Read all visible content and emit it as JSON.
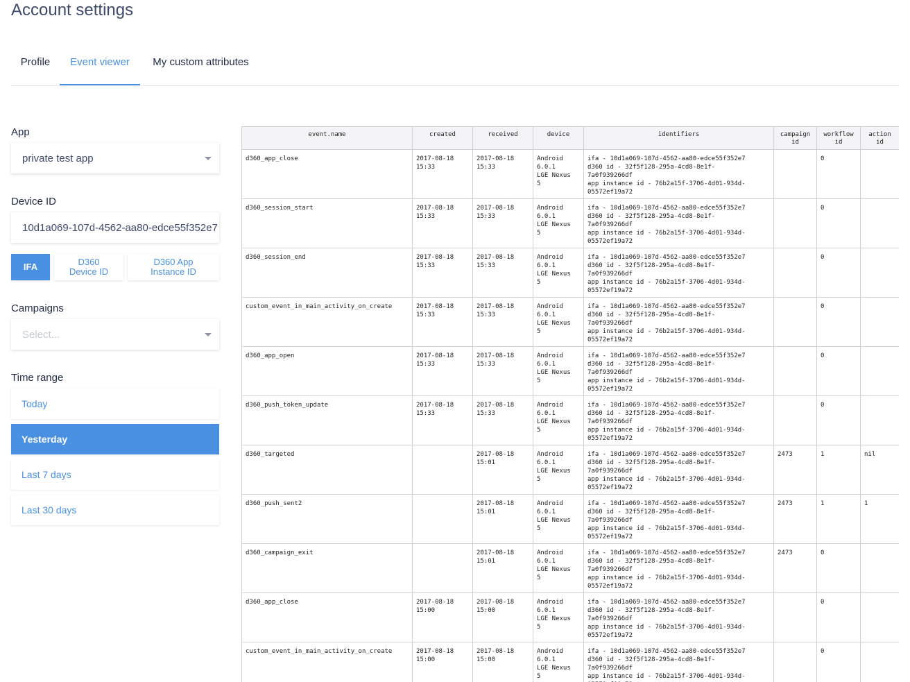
{
  "page_title": "Account settings",
  "tabs": [
    {
      "label": "Profile",
      "active": false
    },
    {
      "label": "Event viewer",
      "active": true
    },
    {
      "label": "My custom attributes",
      "active": false
    }
  ],
  "sidebar": {
    "app": {
      "label": "App",
      "value": "private test app",
      "icon": "chevron-down-icon"
    },
    "device_id": {
      "label": "Device ID",
      "value": "10d1a069-107d-4562-aa80-edce55f352e7"
    },
    "id_types": [
      {
        "label_line1": "IFA",
        "label_line2": "",
        "active": true
      },
      {
        "label_line1": "D360",
        "label_line2": "Device ID",
        "active": false
      },
      {
        "label_line1": "D360 App",
        "label_line2": "Instance ID",
        "active": false
      }
    ],
    "campaigns": {
      "label": "Campaigns",
      "placeholder": "Select...",
      "icon": "chevron-down-icon"
    },
    "time_range": {
      "label": "Time range",
      "options": [
        {
          "label": "Today",
          "active": false
        },
        {
          "label": "Yesterday",
          "active": true
        },
        {
          "label": "Last 7 days",
          "active": false
        },
        {
          "label": "Last 30 days",
          "active": false
        }
      ]
    }
  },
  "table": {
    "columns": [
      {
        "line1": "event.name",
        "line2": ""
      },
      {
        "line1": "created",
        "line2": ""
      },
      {
        "line1": "received",
        "line2": ""
      },
      {
        "line1": "device",
        "line2": ""
      },
      {
        "line1": "identifiers",
        "line2": ""
      },
      {
        "line1": "campaign",
        "line2": "id"
      },
      {
        "line1": "workflow",
        "line2": "id"
      },
      {
        "line1": "action",
        "line2": "id"
      }
    ],
    "identifiers_text": {
      "ifa": "ifa - 10d1a069-107d-4562-aa80-edce55f352e7",
      "d360_1": "d360 id - 32f5f128-295a-4cd8-8e1f-",
      "d360_2": "7a0f939266df",
      "app_1": "app instance id - 76b2a15f-3706-4d01-934d-",
      "app_2": "05572ef19a72"
    },
    "device_lines": [
      "Android",
      "6.0.1",
      "LGE Nexus",
      "5"
    ],
    "rows": [
      {
        "event_name": "d360_app_close",
        "created_date": "2017-08-18",
        "created_time": "15:33",
        "received_date": "2017-08-18",
        "received_time": "15:33",
        "campaign_id": "",
        "workflow_id": "0",
        "action_id": ""
      },
      {
        "event_name": "d360_session_start",
        "created_date": "2017-08-18",
        "created_time": "15:33",
        "received_date": "2017-08-18",
        "received_time": "15:33",
        "campaign_id": "",
        "workflow_id": "0",
        "action_id": ""
      },
      {
        "event_name": "d360_session_end",
        "created_date": "2017-08-18",
        "created_time": "15:33",
        "received_date": "2017-08-18",
        "received_time": "15:33",
        "campaign_id": "",
        "workflow_id": "0",
        "action_id": ""
      },
      {
        "event_name": "custom_event_in_main_activity_on_create",
        "created_date": "2017-08-18",
        "created_time": "15:33",
        "received_date": "2017-08-18",
        "received_time": "15:33",
        "campaign_id": "",
        "workflow_id": "0",
        "action_id": ""
      },
      {
        "event_name": "d360_app_open",
        "created_date": "2017-08-18",
        "created_time": "15:33",
        "received_date": "2017-08-18",
        "received_time": "15:33",
        "campaign_id": "",
        "workflow_id": "0",
        "action_id": ""
      },
      {
        "event_name": "d360_push_token_update",
        "created_date": "2017-08-18",
        "created_time": "15:33",
        "received_date": "2017-08-18",
        "received_time": "15:33",
        "campaign_id": "",
        "workflow_id": "0",
        "action_id": ""
      },
      {
        "event_name": "d360_targeted",
        "created_date": "",
        "created_time": "",
        "received_date": "2017-08-18",
        "received_time": "15:01",
        "campaign_id": "2473",
        "workflow_id": "1",
        "action_id": "nil"
      },
      {
        "event_name": "d360_push_sent2",
        "created_date": "",
        "created_time": "",
        "received_date": "2017-08-18",
        "received_time": "15:01",
        "campaign_id": "2473",
        "workflow_id": "1",
        "action_id": "1"
      },
      {
        "event_name": "d360_campaign_exit",
        "created_date": "",
        "created_time": "",
        "received_date": "2017-08-18",
        "received_time": "15:01",
        "campaign_id": "2473",
        "workflow_id": "0",
        "action_id": ""
      },
      {
        "event_name": "d360_app_close",
        "created_date": "2017-08-18",
        "created_time": "15:00",
        "received_date": "2017-08-18",
        "received_time": "15:00",
        "campaign_id": "",
        "workflow_id": "0",
        "action_id": ""
      },
      {
        "event_name": "custom_event_in_main_activity_on_create",
        "created_date": "2017-08-18",
        "created_time": "15:00",
        "received_date": "2017-08-18",
        "received_time": "15:00",
        "campaign_id": "",
        "workflow_id": "0",
        "action_id": ""
      }
    ]
  }
}
